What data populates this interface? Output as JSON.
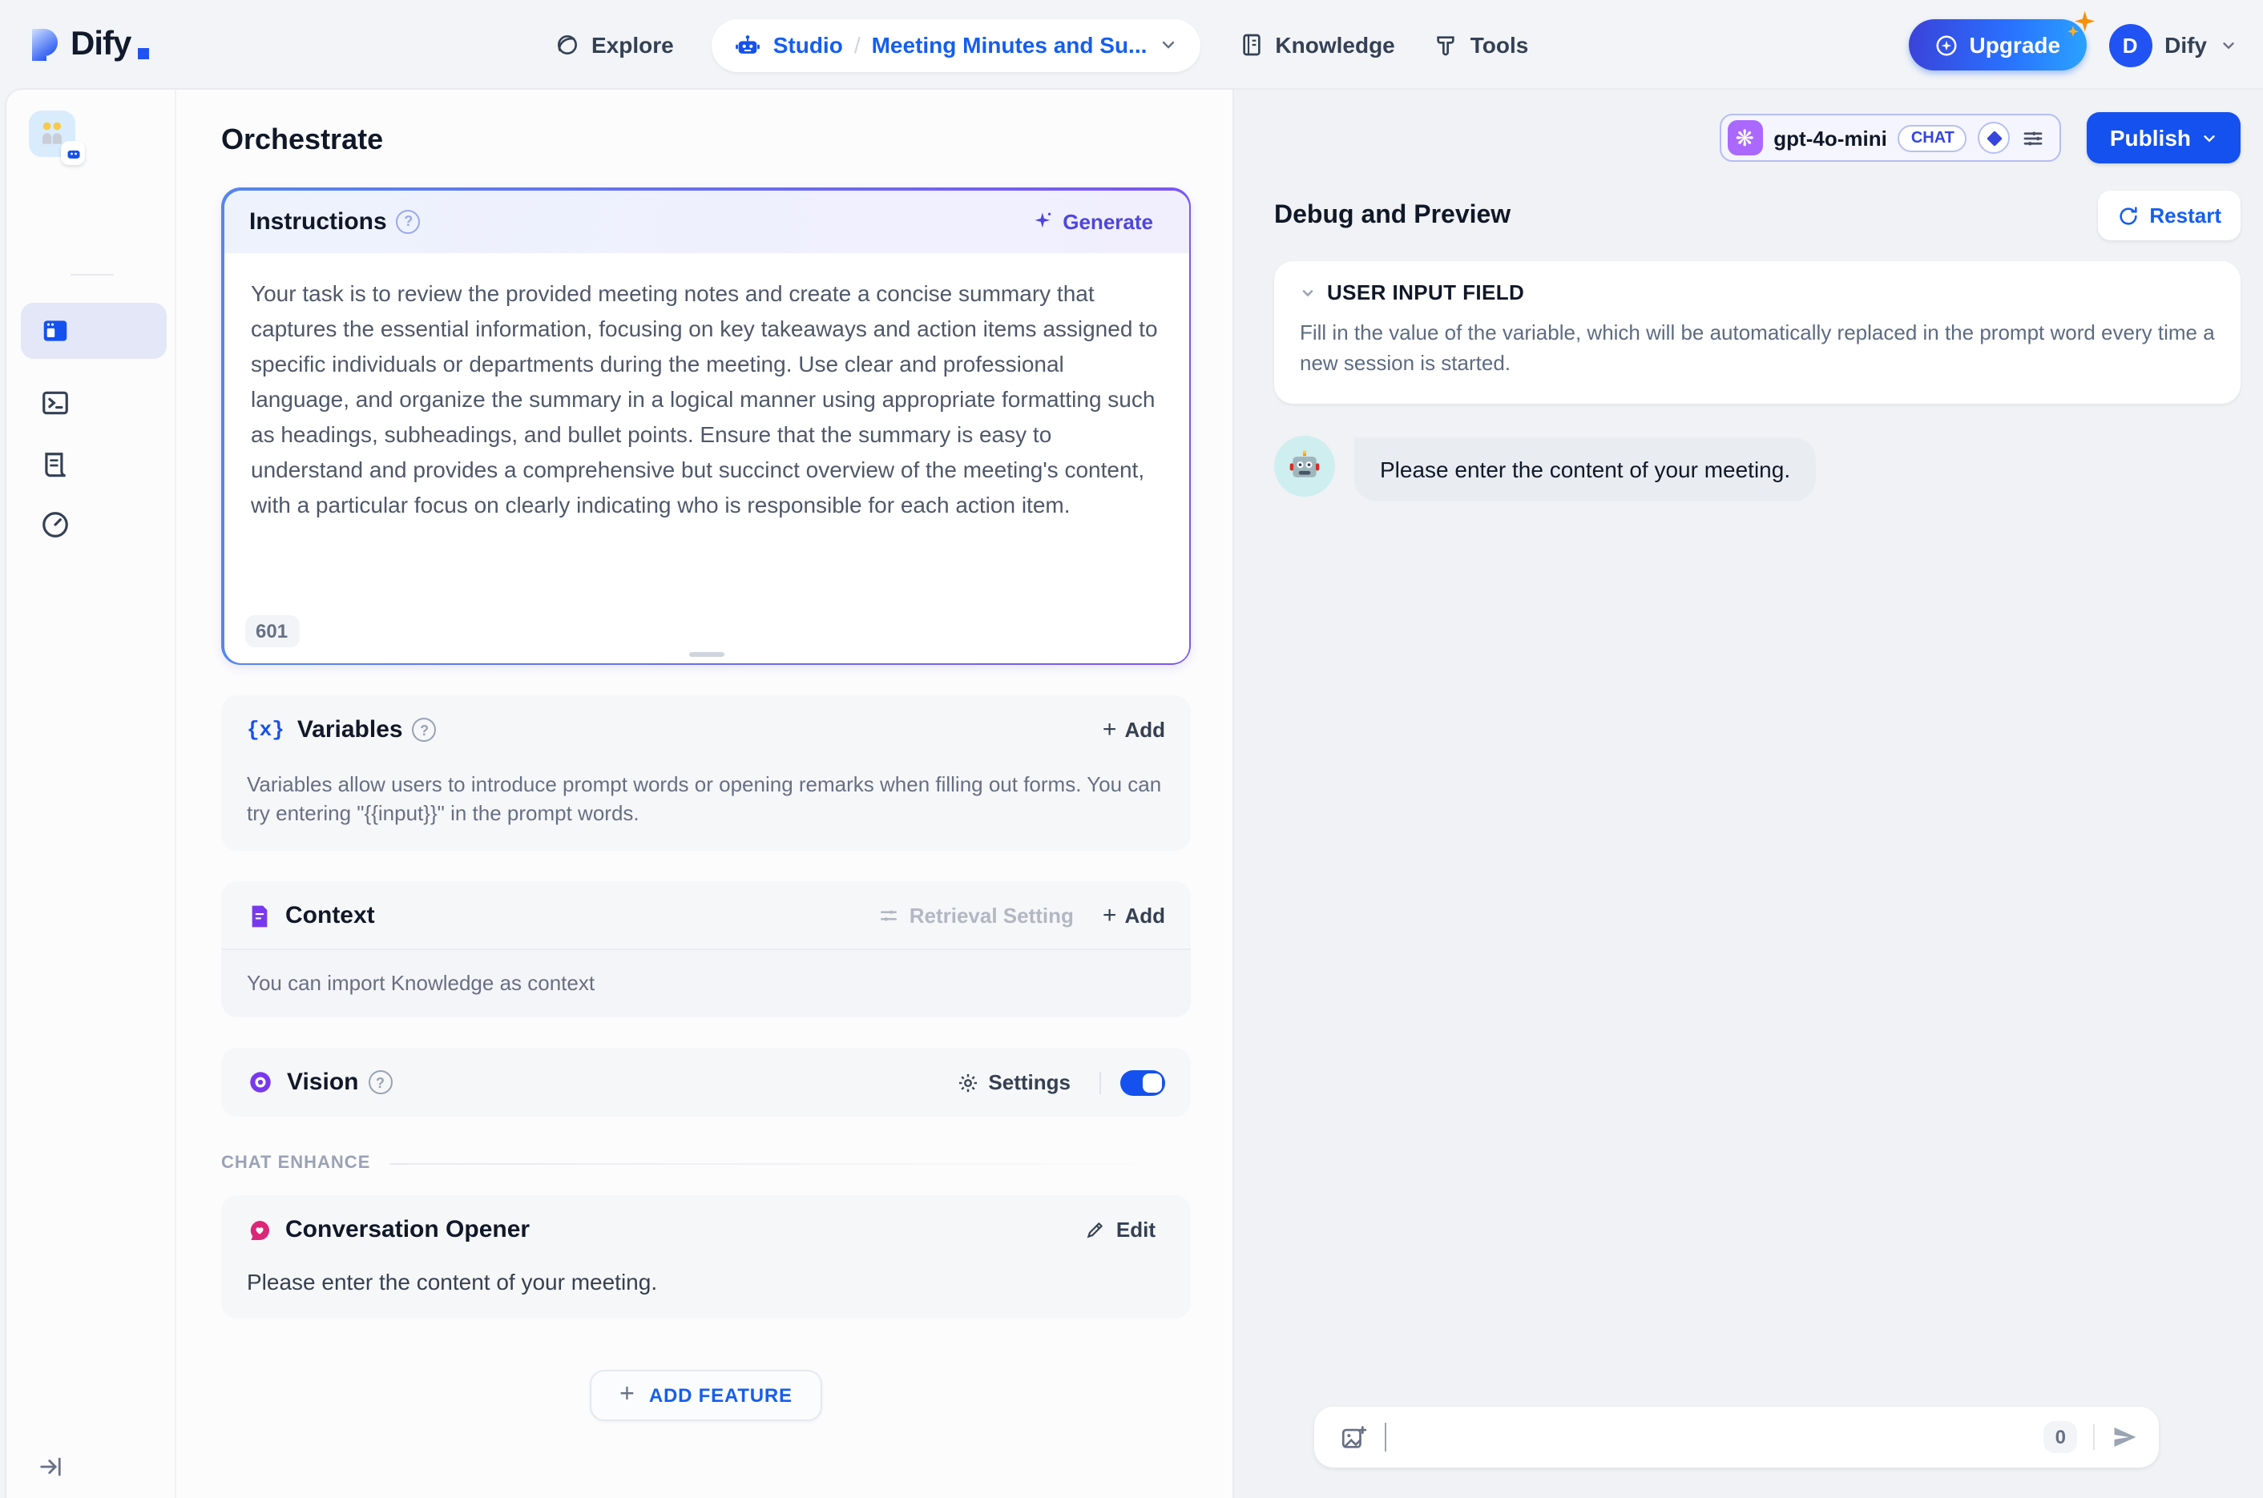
{
  "header": {
    "logo_text": "Dify",
    "nav": {
      "explore": "Explore",
      "studio": "Studio",
      "separator": "/",
      "app_name": "Meeting Minutes and Su...",
      "knowledge": "Knowledge",
      "tools": "Tools"
    },
    "upgrade_label": "Upgrade",
    "avatar_initial": "D",
    "account_name": "Dify"
  },
  "page": {
    "title": "Orchestrate",
    "model": {
      "name": "gpt-4o-mini",
      "mode_badge": "CHAT"
    },
    "publish_label": "Publish"
  },
  "instructions": {
    "title": "Instructions",
    "generate_label": "Generate",
    "text": "Your task is to review the provided meeting notes and create a concise summary that captures the essential information, focusing on key takeaways and action items assigned to specific individuals or departments during the meeting. Use clear and professional language, and organize the summary in a logical manner using appropriate formatting such as headings, subheadings, and bullet points. Ensure that the summary is easy to understand and provides a comprehensive but succinct overview of the meeting's content, with a particular focus on clearly indicating who is responsible for each action item.",
    "char_count": "601"
  },
  "variables": {
    "title": "Variables",
    "icon_glyph": "{x}",
    "add_label": "Add",
    "description": "Variables allow users to introduce prompt words or opening remarks when filling out forms. You can try entering \"{{input}}\" in the prompt words."
  },
  "context": {
    "title": "Context",
    "retrieval_setting_label": "Retrieval Setting",
    "add_label": "Add",
    "description": "You can import Knowledge as context"
  },
  "vision": {
    "title": "Vision",
    "settings_label": "Settings",
    "enabled": true
  },
  "chat_enhance": {
    "section_label": "CHAT ENHANCE",
    "opener": {
      "title": "Conversation Opener",
      "edit_label": "Edit",
      "text": "Please enter the content of your meeting."
    }
  },
  "add_feature_label": "ADD FEATURE",
  "debug": {
    "title": "Debug and Preview",
    "restart_label": "Restart",
    "user_input_field": {
      "title": "USER INPUT FIELD",
      "description": "Fill in the value of the variable, which will be automatically replaced in the prompt word every time a new session is started."
    },
    "bot_message": "Please enter the content of your meeting.",
    "input": {
      "char_count": "0"
    }
  },
  "colors": {
    "primary_blue": "#155eef",
    "indigo_accent": "#4e46dc",
    "purple_accent": "#7839ee",
    "pink_accent": "#db2777",
    "border_gradient_start": "#5586ec",
    "border_gradient_end": "#7b57f0"
  }
}
